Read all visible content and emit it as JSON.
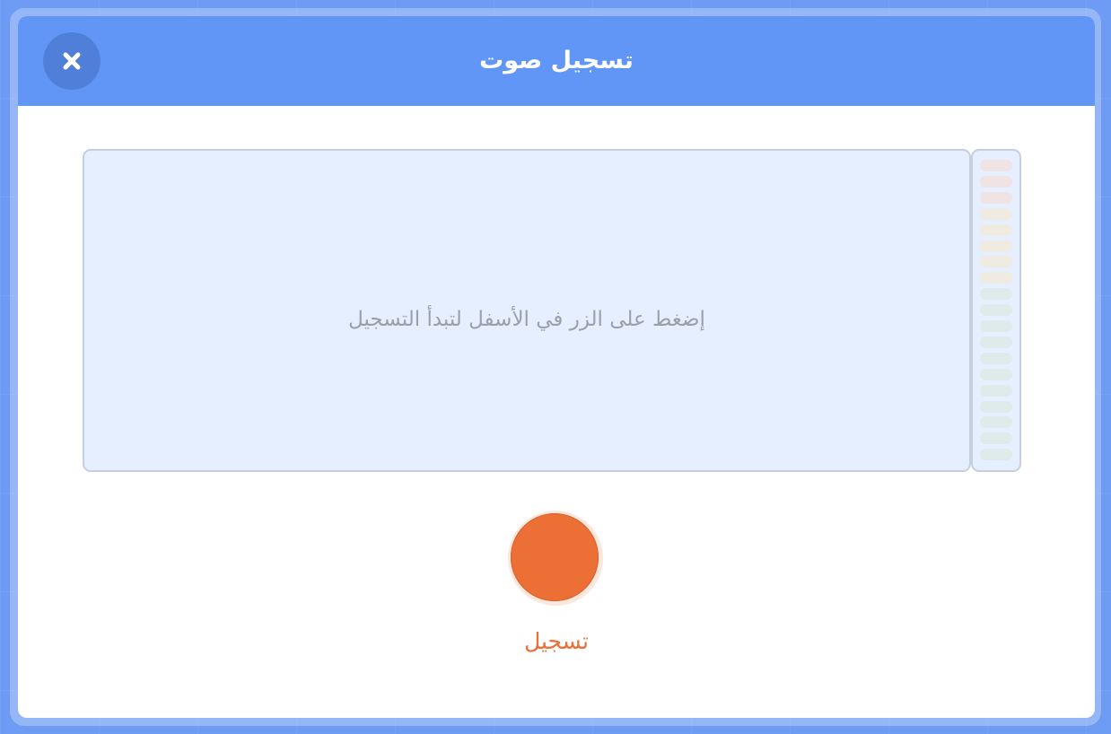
{
  "dialog": {
    "title": "تسجيل صوت",
    "close_icon": "close-x-icon"
  },
  "waveform": {
    "prompt": "إضغط على الزر في الأسفل لتبدأ التسجيل"
  },
  "level_meter": {
    "segments": 19,
    "colors": [
      "#f0e3e3",
      "#f0ebe0",
      "#dfebea"
    ]
  },
  "record": {
    "label": "تسجيل",
    "color": "#ec6f35"
  }
}
